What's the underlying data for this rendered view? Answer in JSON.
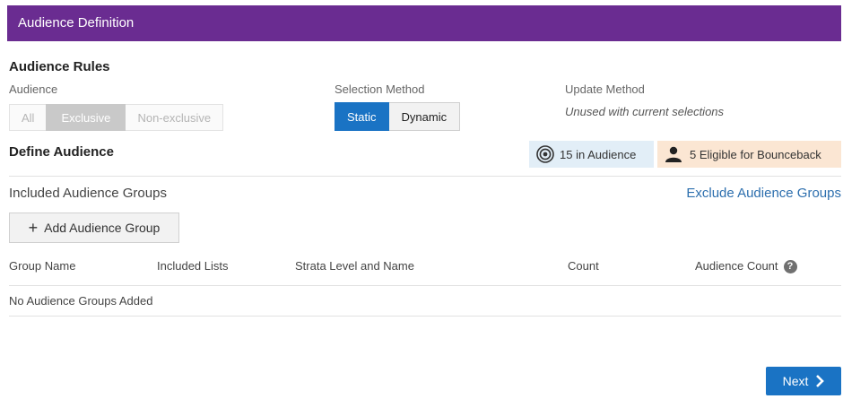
{
  "header": {
    "title": "Audience Definition"
  },
  "audience_rules": {
    "title": "Audience Rules",
    "audience_label": "Audience",
    "audience_options": [
      "All",
      "Exclusive",
      "Non-exclusive"
    ],
    "audience_selected": "Exclusive",
    "selection_method_label": "Selection Method",
    "selection_options": [
      "Static",
      "Dynamic"
    ],
    "selection_selected": "Static",
    "update_method_label": "Update Method",
    "update_method_value": "Unused with current selections"
  },
  "define_audience": {
    "title": "Define Audience",
    "in_audience": "15 in Audience",
    "eligible_bounceback": "5 Eligible for Bounceback"
  },
  "groups": {
    "included_title": "Included Audience Groups",
    "exclude_link": "Exclude Audience Groups",
    "add_button_label": "Add Audience Group",
    "columns": [
      "Group Name",
      "Included Lists",
      "Strata Level and Name",
      "Count",
      "Audience Count"
    ],
    "empty_message": "No Audience Groups Added"
  },
  "footer": {
    "next_label": "Next"
  },
  "colors": {
    "header": "#6a2c91",
    "primary": "#1a73c4",
    "link": "#2d6fae"
  },
  "icons": [
    "target-icon",
    "user-icon",
    "plus-icon",
    "help-icon",
    "chevron-right-icon"
  ]
}
